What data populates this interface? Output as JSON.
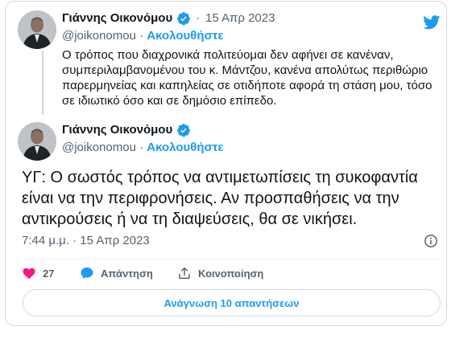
{
  "reply": {
    "author_name": "Γιάννης Οικονόμου",
    "date": "15 Απρ 2023",
    "handle": "@joikonomou",
    "separator": "·",
    "follow_label": "Ακολουθήστε",
    "text": "Ο τρόπος που διαχρονικά πολιτεύομαι δεν αφήνει σε κανέναν, συμπεριλαμβανομένου του κ. Μάντζου, κανένα απολύτως περιθώριο παρερμηνείας και καπηλείας σε οτιδήποτε αφορά τη στάση μου, τόσο σε ιδιωτικό όσο και σε δημόσιο επίπεδο."
  },
  "tweet": {
    "author_name": "Γιάννης Οικονόμου",
    "handle": "@joikonomou",
    "separator": "·",
    "follow_label": "Ακολουθήστε",
    "text": "ΥΓ: Ο σωστός τρόπος να αντιμετωπίσεις τη συκοφαντία είναι να την περιφρονήσεις. Αν προσπαθήσεις να την αντικρούσεις ή να τη διαψεύσεις, θα σε νικήσει.",
    "timestamp": "7:44 μ.μ. · 15 Απρ 2023"
  },
  "actions": {
    "like_count": "27",
    "reply_label": "Απάντηση",
    "share_label": "Κοινοποίηση"
  },
  "read_replies_label": "Ανάγνωση 10 απαντήσεων",
  "colors": {
    "accent": "#1d9bf0",
    "like": "#f91880",
    "verified": "#1d9bf0",
    "secondary_text": "#536471",
    "border": "#cfd9de"
  },
  "icons": {
    "brand": "twitter-bird-icon",
    "verified": "verified-badge-icon",
    "like": "heart-icon",
    "reply": "speech-bubble-icon",
    "share": "share-upload-icon",
    "info": "info-icon"
  }
}
